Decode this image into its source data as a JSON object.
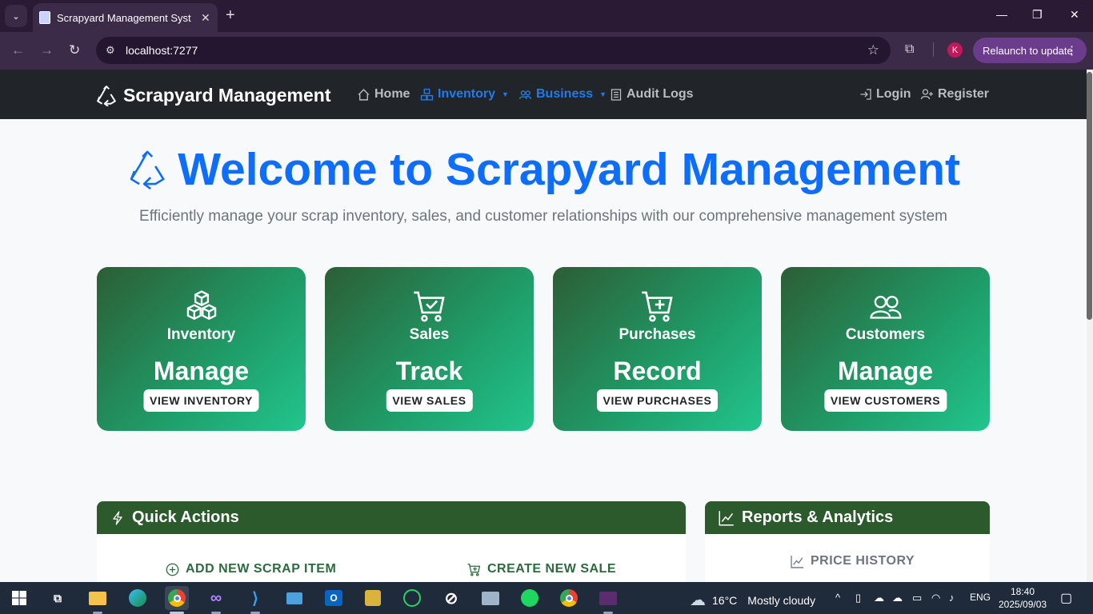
{
  "browser": {
    "tab_title": "Scrapyard Management System",
    "url": "localhost:7277",
    "profile_initial": "K",
    "relaunch_label": "Relaunch to update"
  },
  "navbar": {
    "brand": "Scrapyard Management",
    "items": [
      {
        "label": "Home",
        "icon": "house-icon"
      },
      {
        "label": "Inventory",
        "icon": "boxes-icon"
      },
      {
        "label": "Business",
        "icon": "people-icon"
      },
      {
        "label": "Audit Logs",
        "icon": "journal-icon"
      }
    ],
    "login": "Login",
    "register": "Register"
  },
  "hero": {
    "title": "Welcome to Scrapyard Management",
    "subtitle": "Efficiently manage your scrap inventory, sales, and customer relationships with our comprehensive management system"
  },
  "cards": [
    {
      "label": "Inventory",
      "action": "Manage",
      "button": "VIEW INVENTORY",
      "icon": "boxes-icon"
    },
    {
      "label": "Sales",
      "action": "Track",
      "button": "VIEW SALES",
      "icon": "cart-check-icon"
    },
    {
      "label": "Purchases",
      "action": "Record",
      "button": "VIEW PURCHASES",
      "icon": "cart-plus-icon"
    },
    {
      "label": "Customers",
      "action": "Manage",
      "button": "VIEW CUSTOMERS",
      "icon": "people-icon"
    }
  ],
  "quick_actions": {
    "title": "Quick Actions",
    "items": [
      "ADD NEW SCRAP ITEM",
      "CREATE NEW SALE"
    ]
  },
  "reports": {
    "title": "Reports & Analytics",
    "items": [
      "PRICE HISTORY"
    ]
  },
  "taskbar": {
    "weather_temp": "16°C",
    "weather_desc": "Mostly cloudy",
    "language": "ENG",
    "time": "18:40",
    "date": "2025/09/03"
  },
  "colors": {
    "primary": "#0d6efd",
    "navbar": "#212529",
    "card_green": "#1f9e6a",
    "panel_header": "#2d5a2d"
  }
}
